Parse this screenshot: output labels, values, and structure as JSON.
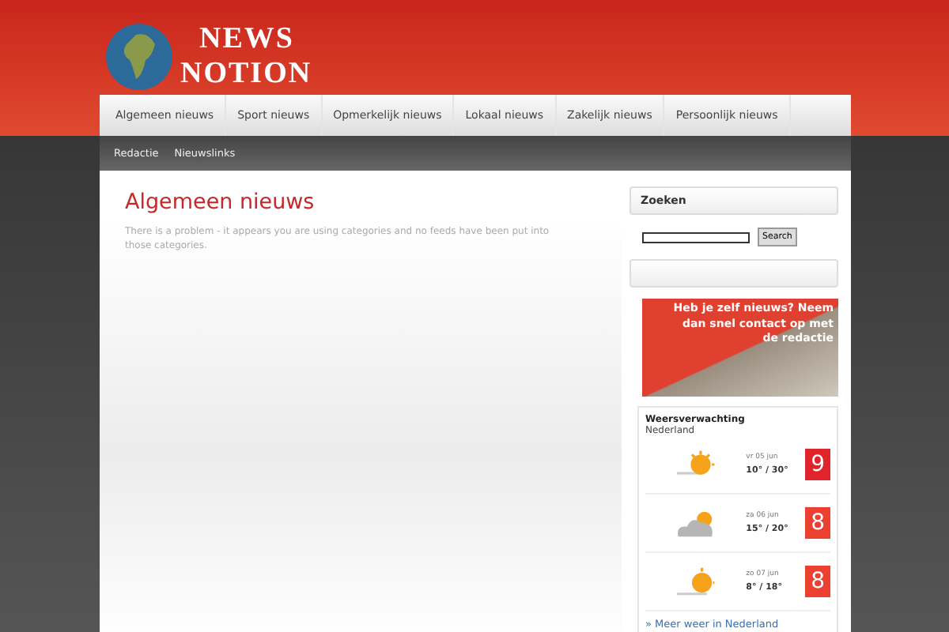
{
  "logo": {
    "line1": "NEWS",
    "line2": "NOTION"
  },
  "nav": [
    {
      "label": "Algemeen nieuws"
    },
    {
      "label": "Sport nieuws"
    },
    {
      "label": "Opmerkelijk nieuws"
    },
    {
      "label": "Lokaal nieuws"
    },
    {
      "label": "Zakelijk nieuws"
    },
    {
      "label": "Persoonlijk nieuws"
    }
  ],
  "subnav": [
    {
      "label": "Redactie"
    },
    {
      "label": "Nieuwslinks"
    }
  ],
  "main": {
    "title": "Algemeen nieuws",
    "message": "There is a problem - it appears you are using categories and no feeds have been put into those categories."
  },
  "sidebar": {
    "search_title": "Zoeken",
    "search_button": "Search",
    "banner_text": "Heb je zelf nieuws? Neem dan snel contact op met de redactie",
    "weather": {
      "title": "Weersverwachting",
      "region": "Nederland",
      "link": "» Meer weer in Nederland",
      "days": [
        {
          "date": "vr 05 jun",
          "temps": "10° / 30°",
          "score": "9",
          "color": "#e0242c",
          "kind": "sun"
        },
        {
          "date": "za 06 jun",
          "temps": "15° / 20°",
          "score": "8",
          "color": "#ec4030",
          "kind": "cloud"
        },
        {
          "date": "zo 07 jun",
          "temps": "8° / 18°",
          "score": "8",
          "color": "#ec4030",
          "kind": "sunset"
        }
      ]
    }
  }
}
